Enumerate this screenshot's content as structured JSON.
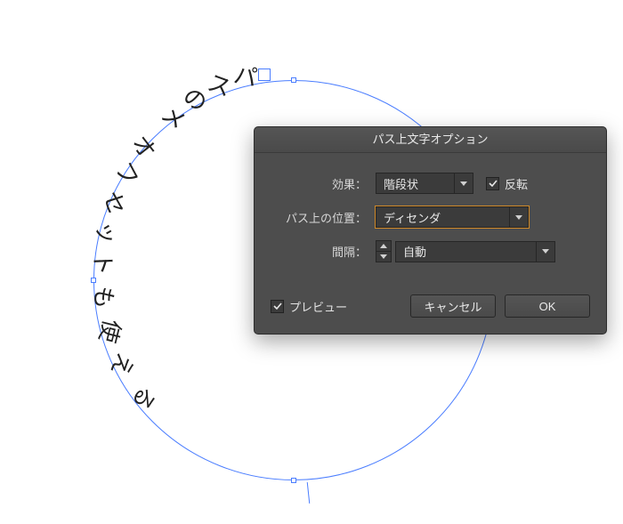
{
  "dialog": {
    "title": "パス上文字オプション",
    "effect": {
      "label": "効果",
      "value": "階段状"
    },
    "flip": {
      "label": "反転",
      "checked": true
    },
    "align": {
      "label": "パス上の位置",
      "value": "ディセンダ"
    },
    "spacing": {
      "label": "間隔",
      "value": "自動"
    },
    "preview": {
      "label": "プレビュー",
      "checked": true
    },
    "cancel": "キャンセル",
    "ok": "OK"
  },
  "path_text": {
    "glyphs": [
      "オ",
      "フ",
      "セ",
      "ッ",
      "ト",
      "も",
      "使",
      "え",
      "る",
      "メ",
      "の",
      "ス",
      "パ"
    ]
  }
}
